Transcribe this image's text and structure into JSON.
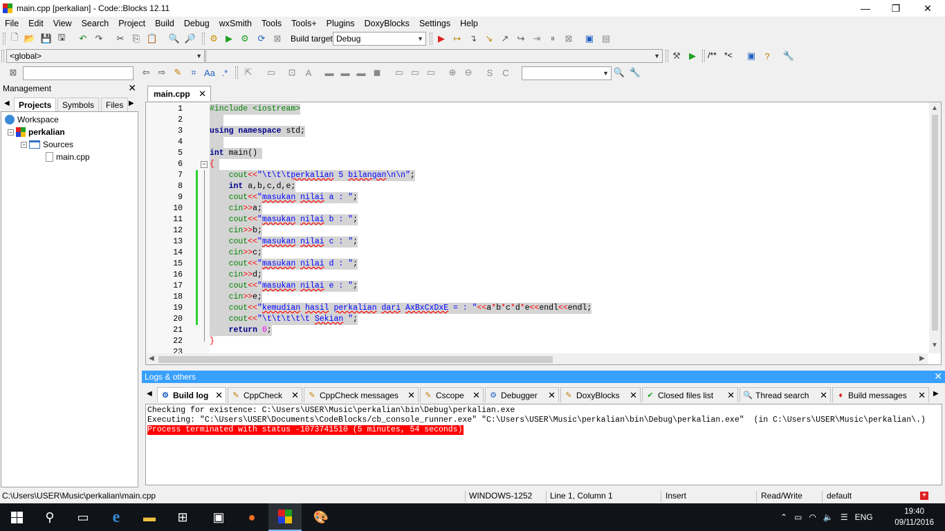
{
  "window": {
    "title": "main.cpp [perkalian] - Code::Blocks 12.11",
    "minimize": "—",
    "maximize": "❐",
    "close": "✕"
  },
  "menu": [
    "File",
    "Edit",
    "View",
    "Search",
    "Project",
    "Build",
    "Debug",
    "wxSmith",
    "Tools",
    "Tools+",
    "Plugins",
    "DoxyBlocks",
    "Settings",
    "Help"
  ],
  "toolbar": {
    "build_target_label": "Build target:",
    "build_target_value": "Debug",
    "scope_value": "<global>",
    "doxy_comment": "/**",
    "doxy_line": "*<"
  },
  "management": {
    "title": "Management",
    "close": "✕",
    "tabs": [
      "Projects",
      "Symbols",
      "Files"
    ],
    "tree": {
      "workspace": "Workspace",
      "project": "perkalian",
      "folder": "Sources",
      "file": "main.cpp"
    }
  },
  "editor": {
    "tab_label": "main.cpp",
    "tab_close": "✕",
    "lines": [
      {
        "n": "1"
      },
      {
        "n": "2"
      },
      {
        "n": "3"
      },
      {
        "n": "4"
      },
      {
        "n": "5"
      },
      {
        "n": "6"
      },
      {
        "n": "7"
      },
      {
        "n": "8"
      },
      {
        "n": "9"
      },
      {
        "n": "10"
      },
      {
        "n": "11"
      },
      {
        "n": "12"
      },
      {
        "n": "13"
      },
      {
        "n": "14"
      },
      {
        "n": "15"
      },
      {
        "n": "16"
      },
      {
        "n": "17"
      },
      {
        "n": "18"
      },
      {
        "n": "19"
      },
      {
        "n": "20"
      },
      {
        "n": "21"
      },
      {
        "n": "22"
      },
      {
        "n": "23"
      }
    ],
    "code": {
      "l1": "#include <iostream>",
      "l3a": "using",
      "l3b": "namespace",
      "l3c": " std;",
      "l5a": "int",
      "l5b": " main()",
      "l6": "{",
      "l7a": "    cout",
      "l7b": "<<",
      "l7c": "\"\\t\\t\\t",
      "l7d": "perkalian",
      "l7e": " 5 ",
      "l7f": "bilangan",
      "l7g": "\\n\\n\"",
      "l7h": ";",
      "l8a": "    ",
      "l8b": "int",
      "l8c": " a,b,c,d,e;",
      "l9a": "    cout",
      "l9b": "<<",
      "l9c": "\"",
      "l9d": "masukan",
      "l9e": " ",
      "l9f": "nilai",
      "l9g": " a : \"",
      "l9h": ";",
      "l10a": "    cin",
      "l10b": ">>",
      "l10c": "a;",
      "l11a": "    cout",
      "l11b": "<<",
      "l11c": "\"",
      "l11d": "masukan",
      "l11e": " ",
      "l11f": "nilai",
      "l11g": " b : \"",
      "l11h": ";",
      "l12a": "    cin",
      "l12b": ">>",
      "l12c": "b;",
      "l13a": "    cout",
      "l13b": "<<",
      "l13c": "\"",
      "l13d": "masukan",
      "l13e": " ",
      "l13f": "nilai",
      "l13g": " c : \"",
      "l13h": ";",
      "l14a": "    cin",
      "l14b": ">>",
      "l14c": "c;",
      "l15a": "    cout",
      "l15b": "<<",
      "l15c": "\"",
      "l15d": "masukan",
      "l15e": " ",
      "l15f": "nilai",
      "l15g": " d : \"",
      "l15h": ";",
      "l16a": "    cin",
      "l16b": ">>",
      "l16c": "d;",
      "l17a": "    cout",
      "l17b": "<<",
      "l17c": "\"",
      "l17d": "masukan",
      "l17e": " ",
      "l17f": "nilai",
      "l17g": " e : \"",
      "l17h": ";",
      "l18a": "    cin",
      "l18b": ">>",
      "l18c": "e;",
      "l19a": "    cout",
      "l19b": "<<",
      "l19c": "\"",
      "l19d": "kemudian",
      "l19e": " ",
      "l19f": "hasil",
      "l19g": " ",
      "l19h": "perkalian",
      "l19i": " ",
      "l19j": "dari",
      "l19k": " ",
      "l19l": "AxBxCxDxE",
      "l19m": " = : \"",
      "l19n": "<<",
      "l19o": "a",
      "l19p": "*",
      "l19q": "b",
      "l19r": "*",
      "l19s": "c",
      "l19t": "*",
      "l19u": "d",
      "l19v": "*",
      "l19w": "e",
      "l19x": "<<",
      "l19y": "endl",
      "l19z": "<<",
      "l19aa": "endl;",
      "l20a": "    cout",
      "l20b": "<<",
      "l20c": "\"\\t\\t\\t\\t\\t ",
      "l20d": "Sekian",
      "l20e": " \"",
      "l20f": ";",
      "l21a": "    ",
      "l21b": "return",
      "l21c": " ",
      "l21d": "0",
      "l21e": ";",
      "l22": "}"
    }
  },
  "logs": {
    "title": "Logs & others",
    "close": "✕",
    "tabs": [
      "Build log",
      "CppCheck",
      "CppCheck messages",
      "Cscope",
      "Debugger",
      "DoxyBlocks",
      "Closed files list",
      "Thread search",
      "Build messages"
    ],
    "lines": [
      "Checking for existence: C:\\Users\\USER\\Music\\perkalian\\bin\\Debug\\perkalian.exe",
      "Executing: \"C:\\Users\\USER\\Documents\\CodeBlocks/cb_console_runner.exe\" \"C:\\Users\\USER\\Music\\perkalian\\bin\\Debug\\perkalian.exe\"  (in C:\\Users\\USER\\Music\\perkalian\\.)",
      "Process terminated with status -1073741510 (5 minutes, 54 seconds)"
    ]
  },
  "status": {
    "path": "C:\\Users\\USER\\Music\\perkalian\\main.cpp",
    "encoding": "WINDOWS-1252",
    "position": "Line 1, Column 1",
    "mode": "Insert",
    "access": "Read/Write",
    "lang": "default"
  },
  "taskbar": {
    "lang": "ENG",
    "time": "19:40",
    "date": "09/11/2016"
  },
  "colors": {
    "accent": "#38a0ff",
    "error_bg": "#ff0000",
    "change_marker": "#2fd02f",
    "selection": "#d4d4d4"
  }
}
